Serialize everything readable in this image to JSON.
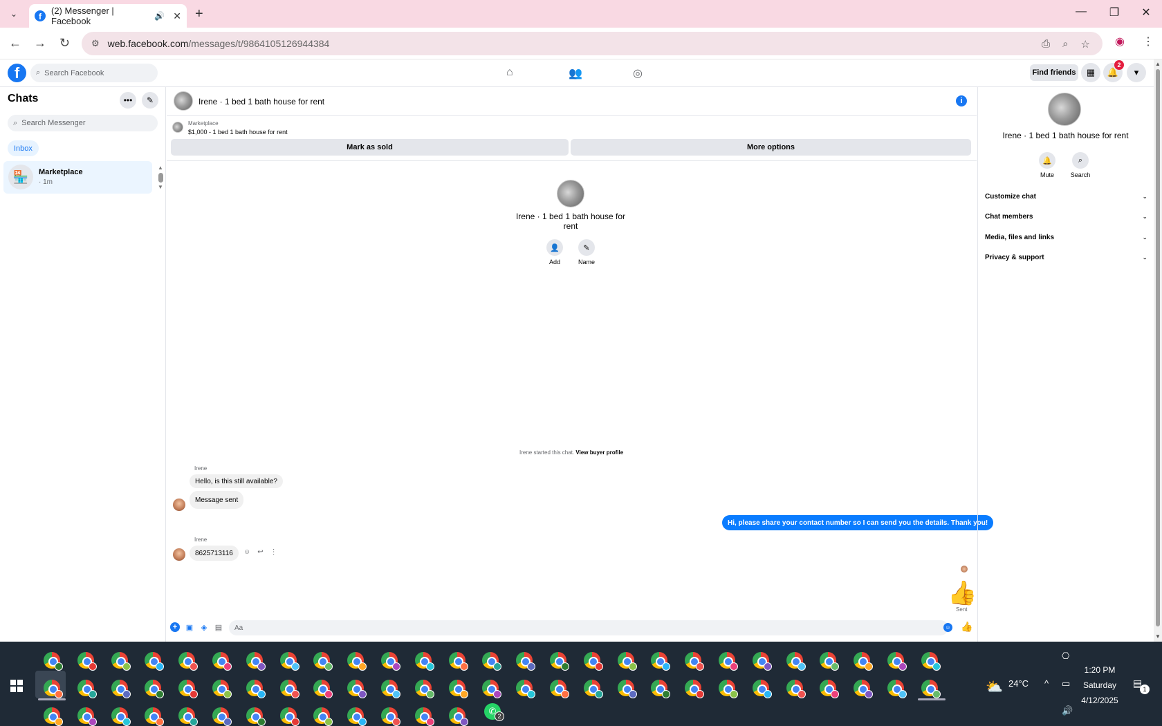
{
  "browser": {
    "tab_title": "(2) Messenger | Facebook",
    "url_host": "web.facebook.com",
    "url_path": "/messages/t/9864105126944384"
  },
  "fb_header": {
    "search_placeholder": "Search Facebook",
    "find_friends": "Find friends",
    "notification_count": "2"
  },
  "chats": {
    "title": "Chats",
    "search_placeholder": "Search Messenger",
    "filter": "Inbox",
    "items": [
      {
        "name": "Marketplace",
        "time": "· 1m"
      }
    ]
  },
  "conversation": {
    "title": "Irene · 1 bed 1 bath house for rent",
    "marketplace_label": "Marketplace",
    "listing": "$1,000 - 1 bed 1 bath house for rent",
    "mark_sold": "Mark as sold",
    "more_options": "More options",
    "profile_name": "Irene · 1 bed 1 bath house for rent",
    "add_label": "Add",
    "name_label": "Name",
    "started_text": "Irene started this chat.",
    "view_buyer": "View buyer profile",
    "messages": [
      {
        "sender": "Irene",
        "text": "Hello, is this still available?"
      },
      {
        "sender": "",
        "text": "Message sent"
      },
      {
        "sender": "me",
        "text": "Hi, please share your contact number so I can send you the details. Thank you!"
      },
      {
        "sender": "Irene",
        "text": "8625713116"
      }
    ],
    "sent_label": "Sent",
    "composer_placeholder": "Aa"
  },
  "details": {
    "name": "Irene · 1 bed 1 bath house for rent",
    "mute": "Mute",
    "search": "Search",
    "sections": [
      "Customize chat",
      "Chat members",
      "Media, files and links",
      "Privacy & support"
    ]
  },
  "taskbar": {
    "weather": "24°C",
    "time": "1:20 PM",
    "day": "Saturday",
    "date": "4/12/2025",
    "whatsapp_badge": "2",
    "notif_badge": "1"
  },
  "colors": {
    "accent": "#1877f2",
    "outgoing_bubble": "#0a7cff",
    "taskbar": "#1f2a36",
    "tab_strip": "#f9d9e3"
  }
}
